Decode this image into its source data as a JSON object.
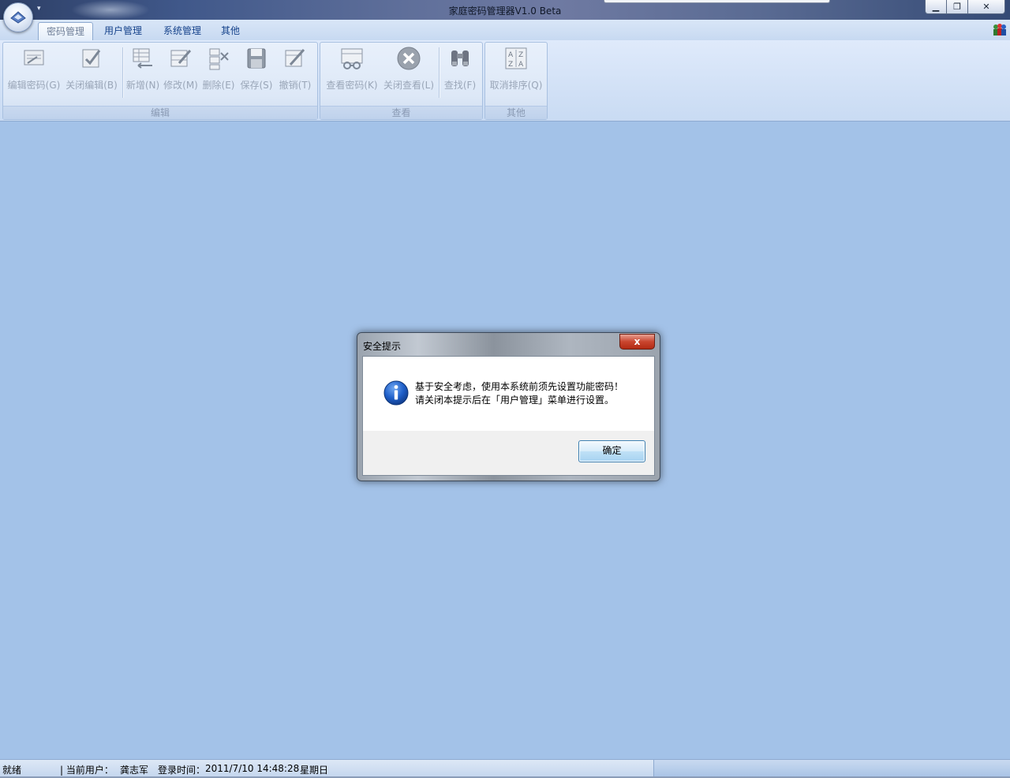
{
  "window": {
    "title": "家庭密码管理器V1.0 Beta",
    "min_glyph": "▁",
    "max_glyph": "❐",
    "close_glyph": "✕"
  },
  "tabs": [
    {
      "label": "密码管理",
      "active": true
    },
    {
      "label": "用户管理",
      "active": false
    },
    {
      "label": "系统管理",
      "active": false
    },
    {
      "label": "其他",
      "active": false
    }
  ],
  "ribbon": {
    "groups": [
      {
        "label": "编辑",
        "buttons": [
          {
            "label": "编辑密码(G)",
            "icon": "edit-password-icon",
            "enabled": false
          },
          {
            "label": "关闭编辑(B)",
            "icon": "close-edit-icon",
            "enabled": false
          },
          {
            "label": "新增(N)",
            "icon": "add-row-icon",
            "enabled": false
          },
          {
            "label": "修改(M)",
            "icon": "modify-icon",
            "enabled": false
          },
          {
            "label": "删除(E)",
            "icon": "delete-icon",
            "enabled": false
          },
          {
            "label": "保存(S)",
            "icon": "save-icon",
            "enabled": false
          },
          {
            "label": "撤销(T)",
            "icon": "undo-icon",
            "enabled": false
          }
        ]
      },
      {
        "label": "查看",
        "buttons": [
          {
            "label": "查看密码(K)",
            "icon": "view-password-icon",
            "enabled": false
          },
          {
            "label": "关闭查看(L)",
            "icon": "close-view-icon",
            "enabled": false
          },
          {
            "label": "查找(F)",
            "icon": "binoculars-icon",
            "enabled": false
          }
        ]
      },
      {
        "label": "其他",
        "buttons": [
          {
            "label": "取消排序(Q)",
            "icon": "sort-az-icon",
            "enabled": false
          }
        ]
      }
    ]
  },
  "dialog": {
    "title": "安全提示",
    "close_glyph": "x",
    "line1": "基于安全考虑，使用本系统前须先设置功能密码！",
    "line2": "请关闭本提示后在「用户管理」菜单进行设置。",
    "ok_label": "确定",
    "icon": "info-icon"
  },
  "status": {
    "ready": "就绪",
    "user_label": "| 当前用户：",
    "user_name": "龚志军",
    "login_label": "登录时间：",
    "login_time": "2011/7/10 14:48:28",
    "weekday": "星期日"
  },
  "colors": {
    "workspace": "#a3c2e8",
    "ribbon_text": "#15428b",
    "disabled_text": "#9aa6b8"
  }
}
